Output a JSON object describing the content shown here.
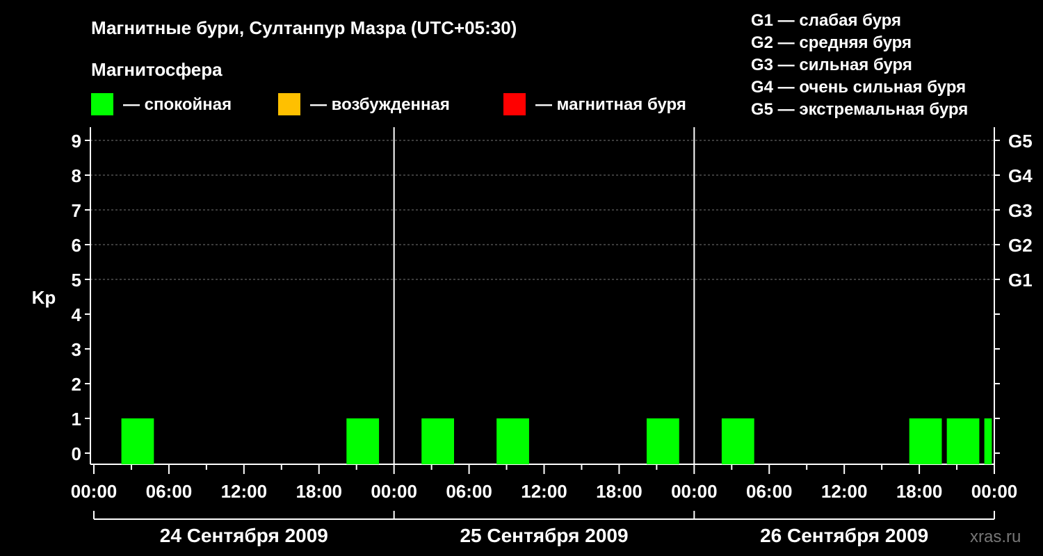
{
  "chart_data": {
    "type": "bar",
    "title": "Магнитные бури, Султанпур Мазра (UTC+05:30)",
    "legend_title": "Магнитосфера",
    "legend": [
      {
        "label": "— спокойная",
        "color": "#00ff00"
      },
      {
        "label": "— возбужденная",
        "color": "#ffc000"
      },
      {
        "label": "— магнитная буря",
        "color": "#ff0000"
      }
    ],
    "g_scale": [
      "G1 — слабая буря",
      "G2 — средняя буря",
      "G3 — сильная буря",
      "G4 — очень сильная буря",
      "G5 — экстремальная буря"
    ],
    "ylabel": "Kp",
    "ylim": [
      0,
      9
    ],
    "y_ticks": [
      "0",
      "1",
      "2",
      "3",
      "4",
      "5",
      "6",
      "7",
      "8",
      "9"
    ],
    "right_ticks": [
      {
        "kp": 5,
        "label": "G1"
      },
      {
        "kp": 6,
        "label": "G2"
      },
      {
        "kp": 7,
        "label": "G3"
      },
      {
        "kp": 8,
        "label": "G4"
      },
      {
        "kp": 9,
        "label": "G5"
      }
    ],
    "x_range_hours": [
      0,
      72
    ],
    "x_tick_labels": [
      "00:00",
      "06:00",
      "12:00",
      "18:00",
      "00:00",
      "06:00",
      "12:00",
      "18:00",
      "00:00",
      "06:00",
      "12:00",
      "18:00",
      "00:00"
    ],
    "days": [
      "24 Сентября 2009",
      "25 Сентября 2009",
      "26 Сентября 2009"
    ],
    "bars": [
      {
        "start_hour": 2.2,
        "end_hour": 4.8,
        "kp": 1,
        "level": "спокойная"
      },
      {
        "start_hour": 20.2,
        "end_hour": 22.8,
        "kp": 1,
        "level": "спокойная"
      },
      {
        "start_hour": 26.2,
        "end_hour": 28.8,
        "kp": 1,
        "level": "спокойная"
      },
      {
        "start_hour": 32.2,
        "end_hour": 34.8,
        "kp": 1,
        "level": "спокойная"
      },
      {
        "start_hour": 44.2,
        "end_hour": 46.8,
        "kp": 1,
        "level": "спокойная"
      },
      {
        "start_hour": 50.2,
        "end_hour": 52.8,
        "kp": 1,
        "level": "спокойная"
      },
      {
        "start_hour": 65.2,
        "end_hour": 67.8,
        "kp": 1,
        "level": "спокойная"
      },
      {
        "start_hour": 68.2,
        "end_hour": 70.8,
        "kp": 1,
        "level": "спокойная"
      },
      {
        "start_hour": 71.2,
        "end_hour": 71.8,
        "kp": 1,
        "level": "спокойная"
      }
    ]
  },
  "watermark": "xras.ru"
}
